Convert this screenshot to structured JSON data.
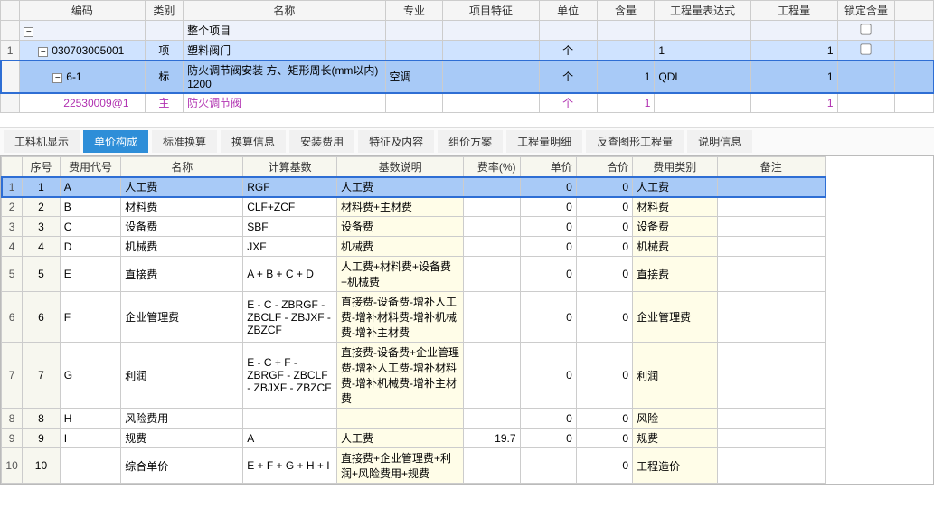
{
  "top": {
    "headers": [
      "",
      "编码",
      "类别",
      "名称",
      "专业",
      "项目特征",
      "单位",
      "含量",
      "工程量表达式",
      "工程量",
      "锁定含量",
      ""
    ],
    "rows": [
      {
        "n": "",
        "code": "",
        "toggle": "-",
        "indent": 0,
        "type": "",
        "name": "整个项目",
        "spec": "",
        "feat": "",
        "unit": "",
        "qty": "",
        "expr": "",
        "eng": "",
        "chk": true,
        "cls": "row-total"
      },
      {
        "n": "1",
        "code": "030703005001",
        "toggle": "-",
        "indent": 1,
        "type": "项",
        "name": "塑料阀门",
        "spec": "",
        "feat": "",
        "unit": "个",
        "qty": "",
        "expr": "1",
        "eng": "1",
        "chk": true,
        "cls": "row-sel"
      },
      {
        "n": "",
        "code": "6-1",
        "toggle": "-",
        "indent": 2,
        "type": "标",
        "name": "防火调节阀安装 方、矩形周长(mm以内) 1200",
        "spec": "空调",
        "feat": "",
        "unit": "个",
        "qty": "1",
        "expr": "QDL",
        "eng": "1",
        "chk": false,
        "cls": "row-sel-hi"
      },
      {
        "n": "",
        "code": "22530009@1",
        "toggle": "",
        "indent": 3,
        "type": "主",
        "name": "防火调节阀",
        "spec": "",
        "feat": "",
        "unit": "个",
        "qty": "1",
        "expr": "",
        "eng": "1",
        "chk": false,
        "cls": "purple-row"
      }
    ]
  },
  "tabs": [
    "工料机显示",
    "单价构成",
    "标准换算",
    "换算信息",
    "安装费用",
    "特征及内容",
    "组价方案",
    "工程量明细",
    "反查图形工程量",
    "说明信息"
  ],
  "activeTab": 1,
  "bottom": {
    "headers": [
      "序号",
      "费用代号",
      "名称",
      "计算基数",
      "基数说明",
      "费率(%)",
      "单价",
      "合价",
      "费用类别",
      "备注"
    ],
    "rows": [
      {
        "n": "1",
        "seq": "1",
        "code": "A",
        "name": "人工费",
        "basis": "RGF",
        "explain": "人工费",
        "rate": "",
        "price": "0",
        "total": "0",
        "cat": "人工费",
        "sel": true
      },
      {
        "n": "2",
        "seq": "2",
        "code": "B",
        "name": "材料费",
        "basis": "CLF+ZCF",
        "explain": "材料费+主材费",
        "rate": "",
        "price": "0",
        "total": "0",
        "cat": "材料费"
      },
      {
        "n": "3",
        "seq": "3",
        "code": "C",
        "name": "设备费",
        "basis": "SBF",
        "explain": "设备费",
        "rate": "",
        "price": "0",
        "total": "0",
        "cat": "设备费"
      },
      {
        "n": "4",
        "seq": "4",
        "code": "D",
        "name": "机械费",
        "basis": "JXF",
        "explain": "机械费",
        "rate": "",
        "price": "0",
        "total": "0",
        "cat": "机械费"
      },
      {
        "n": "5",
        "seq": "5",
        "code": "E",
        "name": "直接费",
        "basis": "A + B + C + D",
        "explain": "人工费+材料费+设备费+机械费",
        "rate": "",
        "price": "0",
        "total": "0",
        "cat": "直接费"
      },
      {
        "n": "6",
        "seq": "6",
        "code": "F",
        "name": "企业管理费",
        "basis": "E - C - ZBRGF - ZBCLF - ZBJXF - ZBZCF",
        "explain": "直接费-设备费-增补人工费-增补材料费-增补机械费-增补主材费",
        "rate": "",
        "price": "0",
        "total": "0",
        "cat": "企业管理费"
      },
      {
        "n": "7",
        "seq": "7",
        "code": "G",
        "name": "利润",
        "basis": "E - C + F - ZBRGF - ZBCLF - ZBJXF - ZBZCF",
        "explain": "直接费-设备费+企业管理费-增补人工费-增补材料费-增补机械费-增补主材费",
        "rate": "",
        "price": "0",
        "total": "0",
        "cat": "利润"
      },
      {
        "n": "8",
        "seq": "8",
        "code": "H",
        "name": "风险费用",
        "basis": "",
        "explain": "",
        "rate": "",
        "price": "0",
        "total": "0",
        "cat": "风险"
      },
      {
        "n": "9",
        "seq": "9",
        "code": "I",
        "name": "规费",
        "basis": "A",
        "explain": "人工费",
        "rate": "19.7",
        "price": "0",
        "total": "0",
        "cat": "规费"
      },
      {
        "n": "10",
        "seq": "10",
        "code": "",
        "name": "综合单价",
        "basis": "E + F + G + H + I",
        "explain": "直接费+企业管理费+利润+风险费用+规费",
        "rate": "",
        "price": "",
        "total": "0",
        "cat": "工程造价"
      }
    ]
  }
}
